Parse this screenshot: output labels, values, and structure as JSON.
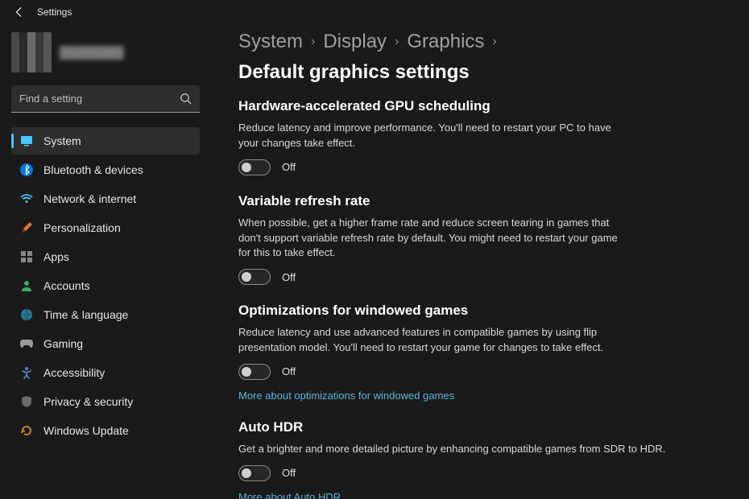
{
  "titlebar": {
    "title": "Settings"
  },
  "search": {
    "placeholder": "Find a setting"
  },
  "sidebar": {
    "items": [
      {
        "label": "System"
      },
      {
        "label": "Bluetooth & devices"
      },
      {
        "label": "Network & internet"
      },
      {
        "label": "Personalization"
      },
      {
        "label": "Apps"
      },
      {
        "label": "Accounts"
      },
      {
        "label": "Time & language"
      },
      {
        "label": "Gaming"
      },
      {
        "label": "Accessibility"
      },
      {
        "label": "Privacy & security"
      },
      {
        "label": "Windows Update"
      }
    ]
  },
  "breadcrumb": {
    "c0": "System",
    "c1": "Display",
    "c2": "Graphics",
    "c3": "Default graphics settings"
  },
  "sections": {
    "gpu": {
      "title": "Hardware-accelerated GPU scheduling",
      "desc": "Reduce latency and improve performance. You'll need to restart your PC to have your changes take effect.",
      "state": "Off"
    },
    "vrr": {
      "title": "Variable refresh rate",
      "desc": "When possible, get a higher frame rate and reduce screen tearing in games that don't support variable refresh rate by default. You might need to restart your game for this to take effect.",
      "state": "Off"
    },
    "win": {
      "title": "Optimizations for windowed games",
      "desc": "Reduce latency and use advanced features in compatible games by using flip presentation model. You'll need to restart your game for changes to take effect.",
      "state": "Off",
      "link": "More about optimizations for windowed games"
    },
    "hdr": {
      "title": "Auto HDR",
      "desc": "Get a brighter and more detailed picture by enhancing compatible games from SDR to HDR.",
      "state": "Off",
      "link": "More about Auto HDR"
    }
  }
}
